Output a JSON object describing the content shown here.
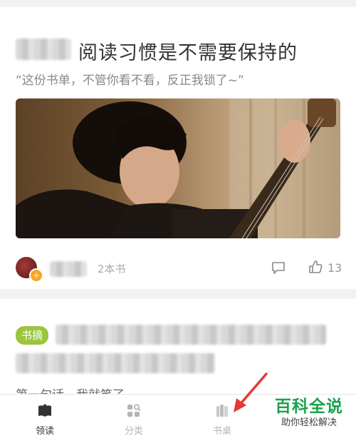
{
  "card1": {
    "title": "阅读习惯是不需要保持的",
    "subtitle": "“这份书单，不管你看不看，反正我锁了~”",
    "photo_icon": "person-with-guitar-photo",
    "book_count": "2本书",
    "like_count": "13",
    "badge_symbol": "+"
  },
  "card2": {
    "tag": "书摘",
    "excerpt": "第一句话，我就笑了"
  },
  "tabbar": {
    "tabs": [
      {
        "label": "领读",
        "icon": "book-open-icon",
        "active": true
      },
      {
        "label": "分类",
        "icon": "grid-search-icon",
        "active": false
      },
      {
        "label": "书桌",
        "icon": "bookshelf-icon",
        "active": false
      }
    ]
  },
  "watermark": {
    "main": "百科全说",
    "sub": "助你轻松解决"
  },
  "colors": {
    "tag_green": "#9bc53d",
    "brand_green": "#1aa34a",
    "arrow_red": "#e53935",
    "active_tab": "#333333",
    "inactive_tab": "#b5b5b5"
  }
}
